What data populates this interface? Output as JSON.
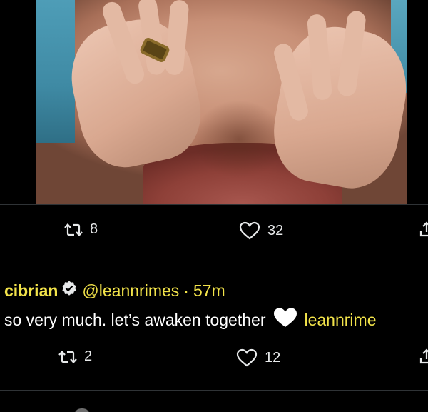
{
  "top_tweet": {
    "media_alt_icon": "video-frame",
    "retweet_count": "8",
    "like_count": "32"
  },
  "reply": {
    "display_name": "cibrian",
    "verified_icon": "verified-badge-icon",
    "handle": "@leannrimes",
    "separator": "·",
    "time": "57m",
    "text": "so very much. let’s awaken together",
    "heart_emoji": "🤍",
    "mention_partial": "leannrime",
    "retweet_count": "2",
    "like_count": "12"
  },
  "colors": {
    "background": "#000000",
    "text": "#e7e9ea",
    "highlight": "#f2e34a",
    "divider": "#2f3336"
  }
}
